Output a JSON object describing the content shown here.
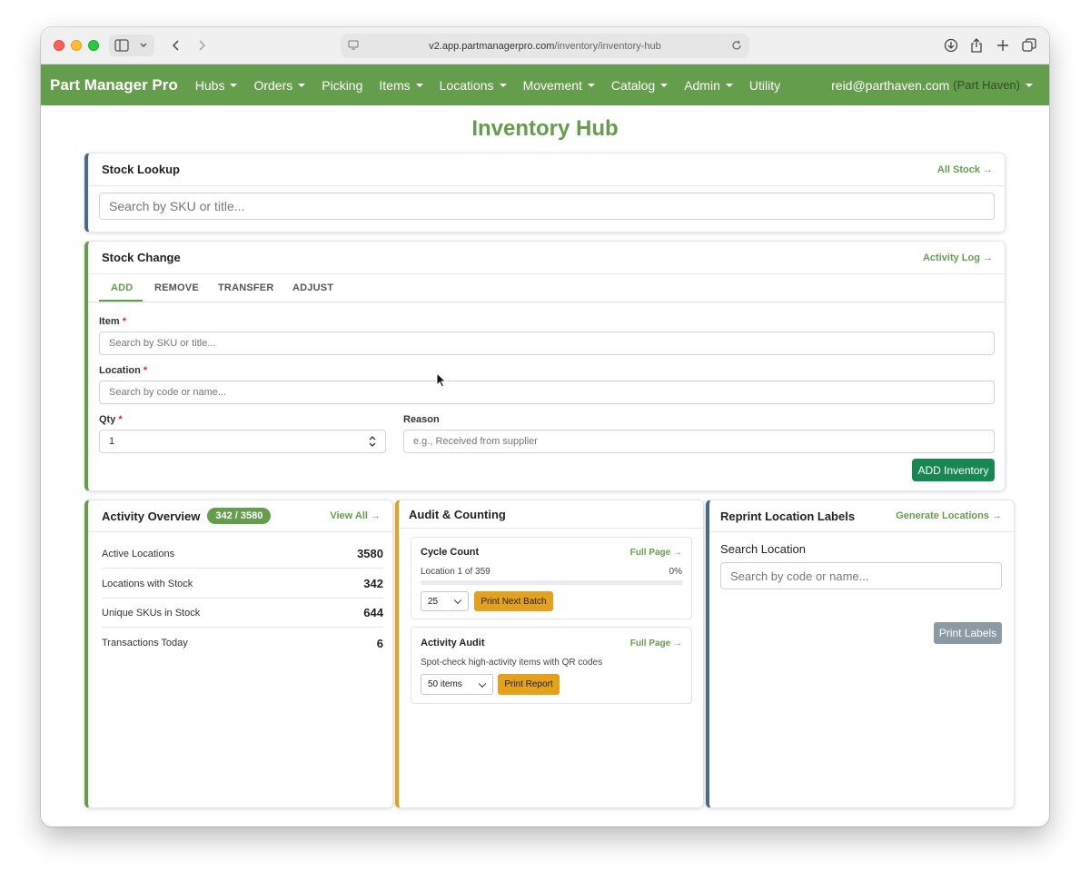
{
  "browser": {
    "url_host": "v2.app.partmanagerpro.com",
    "url_path": "/inventory/inventory-hub"
  },
  "navbar": {
    "brand": "Part Manager Pro",
    "items": [
      {
        "label": "Hubs",
        "dropdown": true
      },
      {
        "label": "Orders",
        "dropdown": true
      },
      {
        "label": "Picking",
        "dropdown": false
      },
      {
        "label": "Items",
        "dropdown": true
      },
      {
        "label": "Locations",
        "dropdown": true
      },
      {
        "label": "Movement",
        "dropdown": true
      },
      {
        "label": "Catalog",
        "dropdown": true
      },
      {
        "label": "Admin",
        "dropdown": true
      },
      {
        "label": "Utility",
        "dropdown": false
      }
    ],
    "user_email": "reid@parthaven.com",
    "user_org": "(Part Haven)"
  },
  "page": {
    "title": "Inventory Hub"
  },
  "stock_lookup": {
    "title": "Stock Lookup",
    "link": "All Stock →",
    "placeholder": "Search by SKU or title..."
  },
  "stock_change": {
    "title": "Stock Change",
    "link": "Activity Log →",
    "tabs": [
      "ADD",
      "REMOVE",
      "TRANSFER",
      "ADJUST"
    ],
    "active_tab": "ADD",
    "item_label": "Item",
    "item_placeholder": "Search by SKU or title...",
    "location_label": "Location",
    "location_placeholder": "Search by code or name...",
    "qty_label": "Qty",
    "qty_value": "1",
    "reason_label": "Reason",
    "reason_placeholder": "e.g., Received from supplier",
    "required_mark": "*",
    "submit_label": "ADD Inventory"
  },
  "activity_overview": {
    "title": "Activity Overview",
    "badge": "342 / 3580",
    "link": "View All →",
    "stats": [
      {
        "label": "Active Locations",
        "value": "3580"
      },
      {
        "label": "Locations with Stock",
        "value": "342"
      },
      {
        "label": "Unique SKUs in Stock",
        "value": "644"
      },
      {
        "label": "Transactions Today",
        "value": "6"
      }
    ]
  },
  "audit": {
    "title": "Audit & Counting",
    "cycle_count": {
      "title": "Cycle Count",
      "link": "Full Page →",
      "progress_text": "Location 1 of 359",
      "progress_percent_text": "0%",
      "progress_fraction": 0,
      "batch_size": "25",
      "button": "Print Next Batch"
    },
    "activity_audit": {
      "title": "Activity Audit",
      "link": "Full Page →",
      "description": "Spot-check high-activity items with QR codes",
      "item_count": "50 items",
      "button": "Print Report"
    }
  },
  "reprint": {
    "title": "Reprint Location Labels",
    "link": "Generate Locations →",
    "search_label": "Search Location",
    "search_placeholder": "Search by code or name...",
    "button": "Print Labels"
  },
  "colors": {
    "brand_green": "#649e4c",
    "submit_green": "#198754",
    "amber": "#e4a11b",
    "slate_accent": "#4a6a8a"
  }
}
